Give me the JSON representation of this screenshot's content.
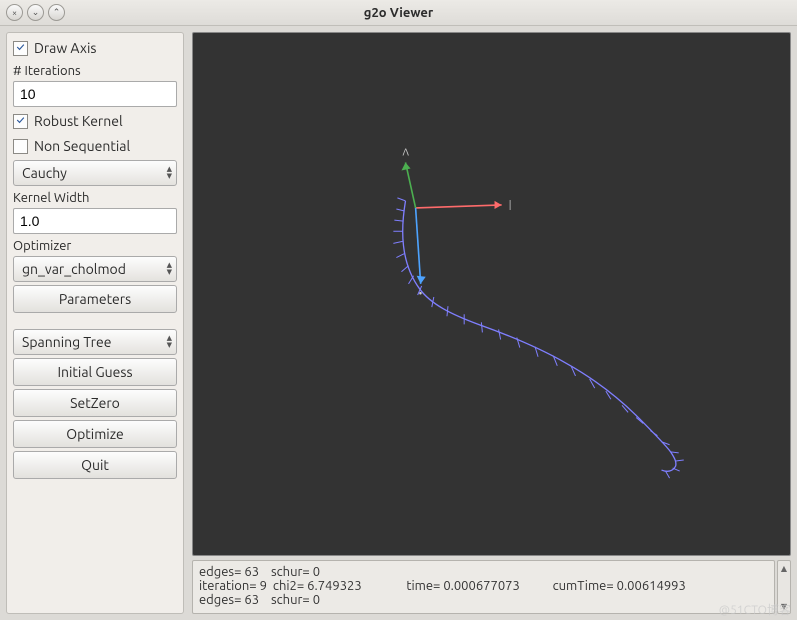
{
  "window": {
    "title": "g2o Viewer",
    "close_icon": "×",
    "min_icon": "⌄",
    "max_icon": "⌃"
  },
  "sidebar": {
    "draw_axis": {
      "label": "Draw Axis",
      "checked": true
    },
    "iterations_label": "# Iterations",
    "iterations_value": "10",
    "robust_kernel": {
      "label": "Robust Kernel",
      "checked": true
    },
    "non_sequential": {
      "label": "Non Sequential",
      "checked": false
    },
    "kernel_type": "Cauchy",
    "kernel_width_label": "Kernel Width",
    "kernel_width_value": "1.0",
    "optimizer_label": "Optimizer",
    "optimizer_value": "gn_var_cholmod",
    "parameters_btn": "Parameters",
    "init_method": "Spanning Tree",
    "initial_guess_btn": "Initial Guess",
    "setzero_btn": "SetZero",
    "optimize_btn": "Optimize",
    "quit_btn": "Quit"
  },
  "status": {
    "line1": "edges= 63    schur= 0",
    "line2": "iteration= 9  chi2= 6.749323               time= 0.000677073           cumTime= 0.00614993",
    "line3": "edges= 63    schur= 0"
  },
  "watermark": "@51CTO博客",
  "axis_labels": {
    "x": "|",
    "y": "ʌ",
    "z": "•"
  },
  "colors": {
    "viewport_bg": "#333333",
    "axis_x": "#ff6b6b",
    "axis_y": "#4caf50",
    "axis_z": "#4da3ff",
    "trajectory": "#7f7fff"
  }
}
